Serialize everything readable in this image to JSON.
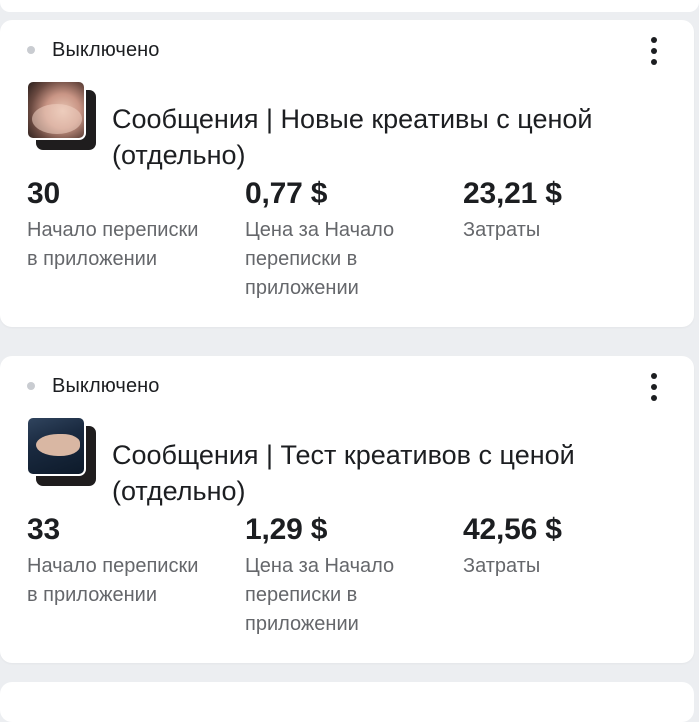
{
  "campaigns": [
    {
      "status": "Выключено",
      "title": "Сообщения | Новые креативы с ценой (отдельно)",
      "thumbnail": "skin-photo",
      "metrics": [
        {
          "value": "30",
          "label": "Начало переписки в приложении"
        },
        {
          "value": "0,77 $",
          "label": "Цена за Начало переписки в приложении"
        },
        {
          "value": "23,21 $",
          "label": "Затраты"
        }
      ]
    },
    {
      "status": "Выключено",
      "title": "Сообщения | Тест креативов с ценой (отдельно)",
      "thumbnail": "hand-photo",
      "metrics": [
        {
          "value": "33",
          "label": "Начало переписки в приложении"
        },
        {
          "value": "1,29 $",
          "label": "Цена за Начало переписки в приложении"
        },
        {
          "value": "42,56 $",
          "label": "Затраты"
        }
      ]
    }
  ],
  "colors": {
    "background": "#eceef1",
    "card": "#ffffff",
    "text_primary": "#1c1e21",
    "text_secondary": "#65676b",
    "status_dot_off": "#c9ccd1"
  },
  "icons": {
    "status": "status-dot-icon",
    "menu": "more-vertical-icon"
  }
}
